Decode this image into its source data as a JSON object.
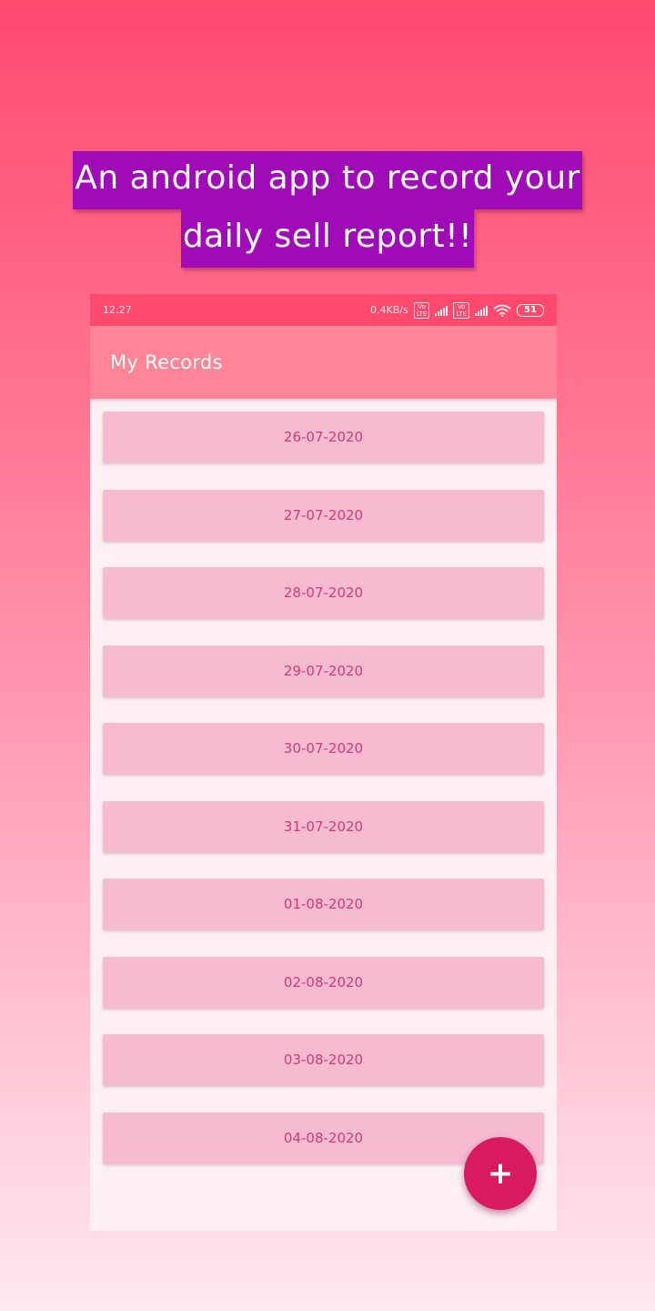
{
  "headline": {
    "line1": "An android app to record your",
    "line2": "daily sell report!!"
  },
  "status_bar": {
    "time": "12:27",
    "network_speed": "0.4KB/s",
    "volte_label": "Vo LTE",
    "battery_level": "51",
    "icons": [
      "volte-icon",
      "signal-icon",
      "volte-icon",
      "signal-icon",
      "wifi-icon",
      "battery-icon"
    ]
  },
  "app_bar": {
    "title": "My Records"
  },
  "records": [
    "26-07-2020",
    "27-07-2020",
    "28-07-2020",
    "29-07-2020",
    "30-07-2020",
    "31-07-2020",
    "01-08-2020",
    "02-08-2020",
    "03-08-2020",
    "04-08-2020"
  ],
  "fab": {
    "label": "+",
    "icon": "add-icon"
  },
  "colors": {
    "headline_bg": "#9e0bb7",
    "status_bar": "#ff4a6e",
    "app_bar": "#ff8597",
    "record_bg": "#f6bad1",
    "record_text": "#d23c72",
    "fab": "#d81b60"
  }
}
